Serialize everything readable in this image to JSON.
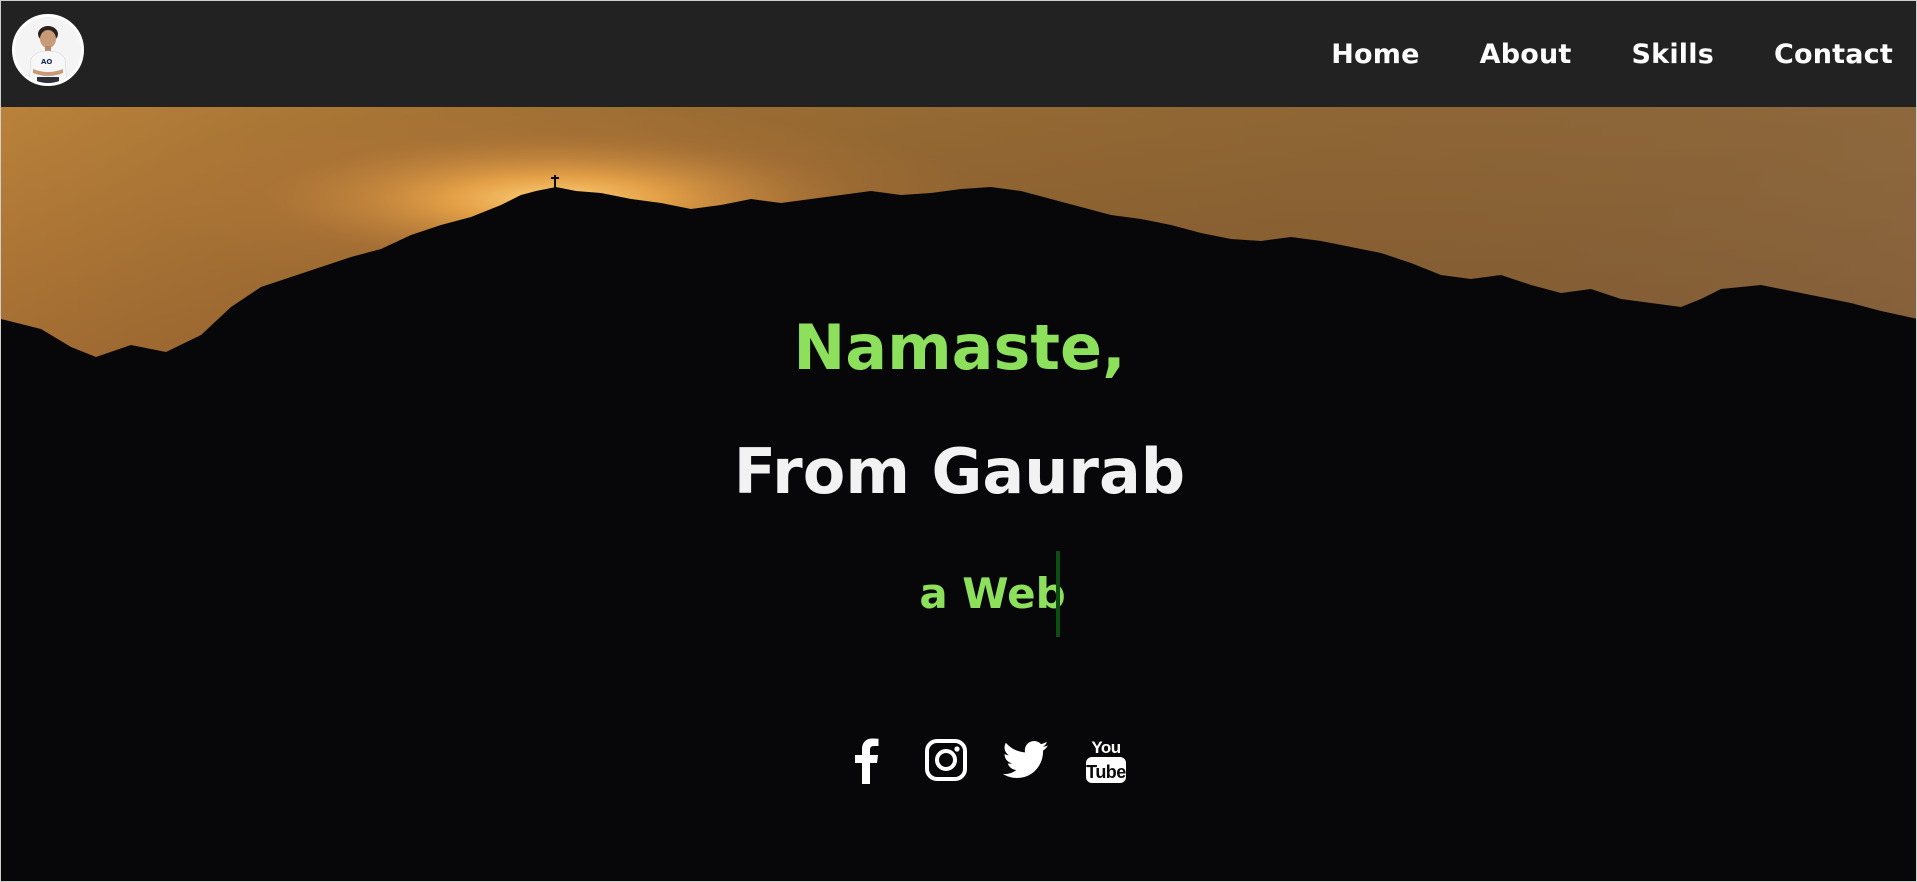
{
  "nav": {
    "avatar_icon": "profile-photo",
    "links": [
      {
        "label": "Home"
      },
      {
        "label": "About"
      },
      {
        "label": "Skills"
      },
      {
        "label": "Contact"
      }
    ]
  },
  "hero": {
    "greeting": "Namaste,",
    "name_line": "From Gaurab",
    "typing_text": "a Web",
    "socials": [
      {
        "icon": "facebook-icon"
      },
      {
        "icon": "instagram-icon"
      },
      {
        "icon": "twitter-icon"
      },
      {
        "icon": "youtube-icon"
      }
    ]
  },
  "colors": {
    "header_bg": "#222222",
    "accent_green": "#8ce05c",
    "caret": "#0d4d12",
    "text_white": "#ffffff"
  }
}
